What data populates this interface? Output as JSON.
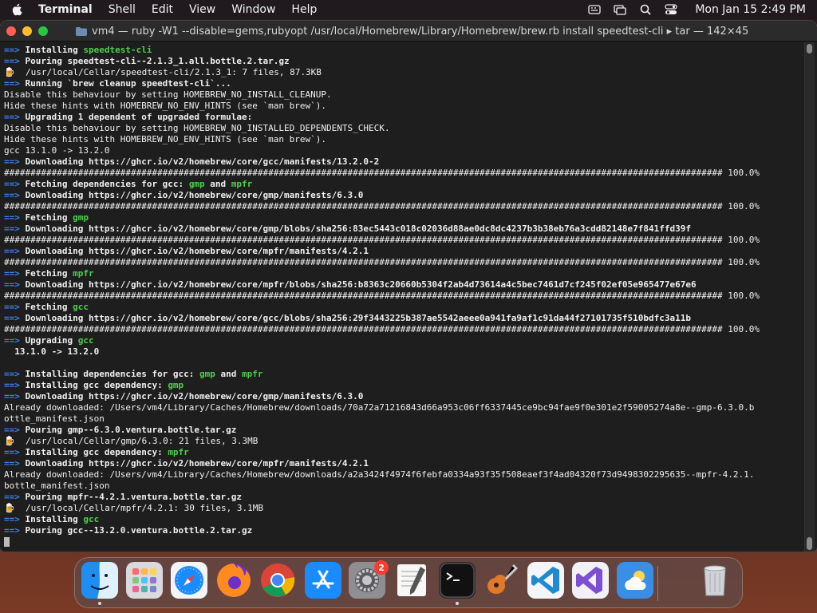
{
  "menubar": {
    "app_name": "Terminal",
    "menus": [
      "Shell",
      "Edit",
      "View",
      "Window",
      "Help"
    ],
    "clock": "Mon Jan 15  2:49 PM"
  },
  "window": {
    "title": "vm4 — ruby -W1 --disable=gems,rubyopt /usr/local/Homebrew/Library/Homebrew/brew.rb install speedtest-cli ▸ tar — 142×45"
  },
  "terminal": {
    "lines": [
      [
        {
          "t": "==> ",
          "c": "arrow"
        },
        {
          "t": "Installing ",
          "c": "b"
        },
        {
          "t": "speedtest-cli",
          "c": "g"
        }
      ],
      [
        {
          "t": "==> ",
          "c": "arrow"
        },
        {
          "t": "Pouring speedtest-cli--2.1.3_1.all.bottle.2.tar.gz",
          "c": "b"
        }
      ],
      [
        {
          "t": "🍺 ",
          "c": "beer"
        },
        {
          "t": " /usr/local/Cellar/speedtest-cli/2.1.3_1: 7 files, 87.3KB",
          "c": ""
        }
      ],
      [
        {
          "t": "==> ",
          "c": "arrow"
        },
        {
          "t": "Running `brew cleanup speedtest-cli`...",
          "c": "b"
        }
      ],
      [
        {
          "t": "Disable this behaviour by setting HOMEBREW_NO_INSTALL_CLEANUP.",
          "c": ""
        }
      ],
      [
        {
          "t": "Hide these hints with HOMEBREW_NO_ENV_HINTS (see `man brew`).",
          "c": ""
        }
      ],
      [
        {
          "t": "==> ",
          "c": "arrow"
        },
        {
          "t": "Upgrading 1 dependent of upgraded formulae:",
          "c": "b"
        }
      ],
      [
        {
          "t": "Disable this behaviour by setting HOMEBREW_NO_INSTALLED_DEPENDENTS_CHECK.",
          "c": ""
        }
      ],
      [
        {
          "t": "Hide these hints with HOMEBREW_NO_ENV_HINTS (see `man brew`).",
          "c": ""
        }
      ],
      [
        {
          "t": "gcc 13.1.0 -> 13.2.0",
          "c": ""
        }
      ],
      [
        {
          "t": "==> ",
          "c": "arrow"
        },
        {
          "t": "Downloading https://ghcr.io/v2/homebrew/core/gcc/manifests/13.2.0-2",
          "c": "b"
        }
      ],
      [
        {
          "t": "######################################################################################################################################## 100.0%",
          "c": ""
        }
      ],
      [
        {
          "t": "==> ",
          "c": "arrow"
        },
        {
          "t": "Fetching dependencies for gcc: ",
          "c": "b"
        },
        {
          "t": "gmp",
          "c": "g"
        },
        {
          "t": " and ",
          "c": "b"
        },
        {
          "t": "mpfr",
          "c": "g"
        }
      ],
      [
        {
          "t": "==> ",
          "c": "arrow"
        },
        {
          "t": "Downloading https://ghcr.io/v2/homebrew/core/gmp/manifests/6.3.0",
          "c": "b"
        }
      ],
      [
        {
          "t": "######################################################################################################################################## 100.0%",
          "c": ""
        }
      ],
      [
        {
          "t": "==> ",
          "c": "arrow"
        },
        {
          "t": "Fetching ",
          "c": "b"
        },
        {
          "t": "gmp",
          "c": "g"
        }
      ],
      [
        {
          "t": "==> ",
          "c": "arrow"
        },
        {
          "t": "Downloading https://ghcr.io/v2/homebrew/core/gmp/blobs/sha256:83ec5443c018c02036d88ae0dc8dc4237b3b38eb76a3cdd82148e7f841ffd39f",
          "c": "b"
        }
      ],
      [
        {
          "t": "######################################################################################################################################## 100.0%",
          "c": ""
        }
      ],
      [
        {
          "t": "==> ",
          "c": "arrow"
        },
        {
          "t": "Downloading https://ghcr.io/v2/homebrew/core/mpfr/manifests/4.2.1",
          "c": "b"
        }
      ],
      [
        {
          "t": "######################################################################################################################################## 100.0%",
          "c": ""
        }
      ],
      [
        {
          "t": "==> ",
          "c": "arrow"
        },
        {
          "t": "Fetching ",
          "c": "b"
        },
        {
          "t": "mpfr",
          "c": "g"
        }
      ],
      [
        {
          "t": "==> ",
          "c": "arrow"
        },
        {
          "t": "Downloading https://ghcr.io/v2/homebrew/core/mpfr/blobs/sha256:b8363c20660b5304f2ab4d73614a4c5bec7461d7cf245f02ef05e965477e67e6",
          "c": "b"
        }
      ],
      [
        {
          "t": "######################################################################################################################################## 100.0%",
          "c": ""
        }
      ],
      [
        {
          "t": "==> ",
          "c": "arrow"
        },
        {
          "t": "Fetching ",
          "c": "b"
        },
        {
          "t": "gcc",
          "c": "g"
        }
      ],
      [
        {
          "t": "==> ",
          "c": "arrow"
        },
        {
          "t": "Downloading https://ghcr.io/v2/homebrew/core/gcc/blobs/sha256:29f3443225b387ae5542aeee0a941fa9af1c91da44f27101735f510bdfc3a11b",
          "c": "b"
        }
      ],
      [
        {
          "t": "######################################################################################################################################## 100.0%",
          "c": ""
        }
      ],
      [
        {
          "t": "==> ",
          "c": "arrow"
        },
        {
          "t": "Upgrading ",
          "c": "b"
        },
        {
          "t": "gcc",
          "c": "g"
        }
      ],
      [
        {
          "t": "  13.1.0 -> 13.2.0",
          "c": "b"
        }
      ],
      [
        {
          "t": "",
          "c": ""
        }
      ],
      [
        {
          "t": "==> ",
          "c": "arrow"
        },
        {
          "t": "Installing dependencies for gcc: ",
          "c": "b"
        },
        {
          "t": "gmp",
          "c": "g"
        },
        {
          "t": " and ",
          "c": "b"
        },
        {
          "t": "mpfr",
          "c": "g"
        }
      ],
      [
        {
          "t": "==> ",
          "c": "arrow"
        },
        {
          "t": "Installing gcc dependency: ",
          "c": "b"
        },
        {
          "t": "gmp",
          "c": "g"
        }
      ],
      [
        {
          "t": "==> ",
          "c": "arrow"
        },
        {
          "t": "Downloading https://ghcr.io/v2/homebrew/core/gmp/manifests/6.3.0",
          "c": "b"
        }
      ],
      [
        {
          "t": "Already downloaded: /Users/vm4/Library/Caches/Homebrew/downloads/70a72a71216843d66a953c06ff6337445ce9bc94fae9f0e301e2f59005274a8e--gmp-6.3.0.b",
          "c": ""
        }
      ],
      [
        {
          "t": "ottle_manifest.json",
          "c": ""
        }
      ],
      [
        {
          "t": "==> ",
          "c": "arrow"
        },
        {
          "t": "Pouring gmp--6.3.0.ventura.bottle.tar.gz",
          "c": "b"
        }
      ],
      [
        {
          "t": "🍺 ",
          "c": "beer"
        },
        {
          "t": " /usr/local/Cellar/gmp/6.3.0: 21 files, 3.3MB",
          "c": ""
        }
      ],
      [
        {
          "t": "==> ",
          "c": "arrow"
        },
        {
          "t": "Installing gcc dependency: ",
          "c": "b"
        },
        {
          "t": "mpfr",
          "c": "g"
        }
      ],
      [
        {
          "t": "==> ",
          "c": "arrow"
        },
        {
          "t": "Downloading https://ghcr.io/v2/homebrew/core/mpfr/manifests/4.2.1",
          "c": "b"
        }
      ],
      [
        {
          "t": "Already downloaded: /Users/vm4/Library/Caches/Homebrew/downloads/a2a3424f4974f6febfa0334a93f35f508eaef3f4ad04320f73d9498302295635--mpfr-4.2.1.",
          "c": ""
        }
      ],
      [
        {
          "t": "bottle_manifest.json",
          "c": ""
        }
      ],
      [
        {
          "t": "==> ",
          "c": "arrow"
        },
        {
          "t": "Pouring mpfr--4.2.1.ventura.bottle.tar.gz",
          "c": "b"
        }
      ],
      [
        {
          "t": "🍺 ",
          "c": "beer"
        },
        {
          "t": " /usr/local/Cellar/mpfr/4.2.1: 30 files, 3.1MB",
          "c": ""
        }
      ],
      [
        {
          "t": "==> ",
          "c": "arrow"
        },
        {
          "t": "Installing ",
          "c": "b"
        },
        {
          "t": "gcc",
          "c": "g"
        }
      ],
      [
        {
          "t": "==> ",
          "c": "arrow"
        },
        {
          "t": "Pouring gcc--13.2.0.ventura.bottle.2.tar.gz",
          "c": "b"
        }
      ]
    ]
  },
  "dock": {
    "apps": [
      {
        "name": "finder",
        "icon": "finder-icon",
        "running": true
      },
      {
        "name": "launchpad",
        "icon": "launchpad-icon",
        "running": false
      },
      {
        "name": "safari",
        "icon": "safari-icon",
        "running": false
      },
      {
        "name": "firefox",
        "icon": "firefox-icon",
        "running": false
      },
      {
        "name": "chrome",
        "icon": "chrome-icon",
        "running": false
      },
      {
        "name": "app-store",
        "icon": "app-store-icon",
        "running": false
      },
      {
        "name": "system-settings",
        "icon": "gear-icon",
        "running": false,
        "badge": "2"
      },
      {
        "name": "textedit",
        "icon": "textedit-icon",
        "running": false
      },
      {
        "name": "terminal",
        "icon": "terminal-icon",
        "running": true
      },
      {
        "name": "garageband",
        "icon": "guitar-icon",
        "running": false
      },
      {
        "name": "vscode",
        "icon": "vscode-icon",
        "running": false
      },
      {
        "name": "visual-studio",
        "icon": "visual-studio-icon",
        "running": false
      },
      {
        "name": "weather",
        "icon": "weather-icon",
        "running": false
      },
      {
        "name": "trash",
        "icon": "trash-icon",
        "running": false
      }
    ]
  }
}
